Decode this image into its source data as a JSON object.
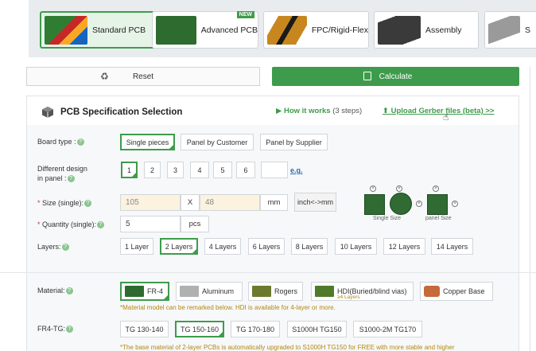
{
  "product_tabs": [
    {
      "label": "Standard PCB",
      "active": true
    },
    {
      "label": "Advanced PCB",
      "badge": "NEW"
    },
    {
      "label": "FPC/Rigid-Flex"
    },
    {
      "label": "Assembly"
    },
    {
      "label": "S"
    }
  ],
  "actions": {
    "reset_label": "Reset",
    "calculate_label": "Calculate"
  },
  "panel": {
    "title": "PCB Specification Selection",
    "how_label": "How it works",
    "how_steps": "(3 steps)",
    "upload_label": "Upload Gerber files (beta) >>"
  },
  "board_type": {
    "label": "Board type :",
    "options": [
      "Single pieces",
      "Panel by Customer",
      "Panel by Supplier"
    ],
    "selected": "Single pieces"
  },
  "designs": {
    "label_line1": "Different design",
    "label_line2": "in panel :",
    "options": [
      "1",
      "2",
      "3",
      "4",
      "5",
      "6"
    ],
    "selected": "1",
    "custom_value": "",
    "eg_label": "e.g."
  },
  "size": {
    "label": "Size (single):",
    "width": "105",
    "sep": "X",
    "height": "48",
    "unit": "mm",
    "unit_toggle": "inch<->mm",
    "single_caption": "Single Size",
    "panel_caption": "panel Size"
  },
  "quantity": {
    "label": "Quantity (single):",
    "value": "5",
    "unit": "pcs"
  },
  "layers": {
    "label": "Layers:",
    "options": [
      "1 Layer",
      "2 Layers",
      "4 Layers",
      "6 Layers",
      "8 Layers",
      "10 Layers",
      "12 Layers",
      "14 Layers"
    ],
    "selected": "2 Layers"
  },
  "material": {
    "label": "Material:",
    "options": [
      "FR-4",
      "Aluminum",
      "Rogers",
      "HDI(Buried/blind vias)",
      "Copper Base"
    ],
    "hdi_sub": "≥4 Layers",
    "selected": "FR-4",
    "note": "*Material model can be remarked below. HDI is available for 4-layer or more."
  },
  "tg": {
    "label": "FR4-TG:",
    "options": [
      "TG 130-140",
      "TG 150-160",
      "TG 170-180",
      "S1000H TG150",
      "S1000-2M TG170"
    ],
    "selected": "TG 150-160",
    "note": "*The base material of 2-layer PCBs is automatically upgraded to S1000H TG150 for FREE with more stable and higher"
  },
  "colors": {
    "accent": "#3e9b4c",
    "link": "#2a6db5",
    "note": "#b8860b"
  }
}
